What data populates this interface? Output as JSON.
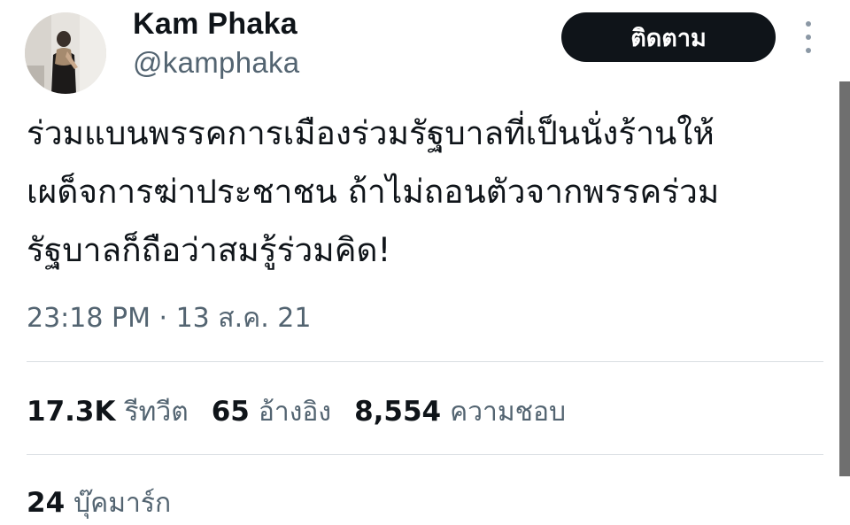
{
  "author": {
    "display_name": "Kam Phaka",
    "handle": "@kamphaka",
    "avatar_icon": "profile-photo"
  },
  "actions": {
    "follow_label": "ติดตาม",
    "more_icon": "more-vertical-icon"
  },
  "tweet": {
    "lines": [
      "ร่วมแบนพรรคการเมืองร่วมรัฐบาลที่เป็นนั่งร้านให้",
      "เผด็จการฆ่าประชาชน ถ้าไม่ถอนตัวจากพรรคร่วม",
      "รัฐบาลก็ถือว่าสมรู้ร่วมคิด!"
    ],
    "timestamp": "23:18 PM · 13 ส.ค. 21"
  },
  "stats": {
    "retweets": {
      "count": "17.3K",
      "label": "รีทวีต"
    },
    "quotes": {
      "count": "65",
      "label": "อ้างอิง"
    },
    "likes": {
      "count": "8,554",
      "label": "ความชอบ"
    }
  },
  "bookmarks": {
    "count": "24",
    "label": "บุ๊คมาร์ก"
  },
  "colors": {
    "text_primary": "#0f1419",
    "text_secondary": "#536471",
    "button_bg": "#0f1419",
    "divider": "#d9dee2"
  }
}
